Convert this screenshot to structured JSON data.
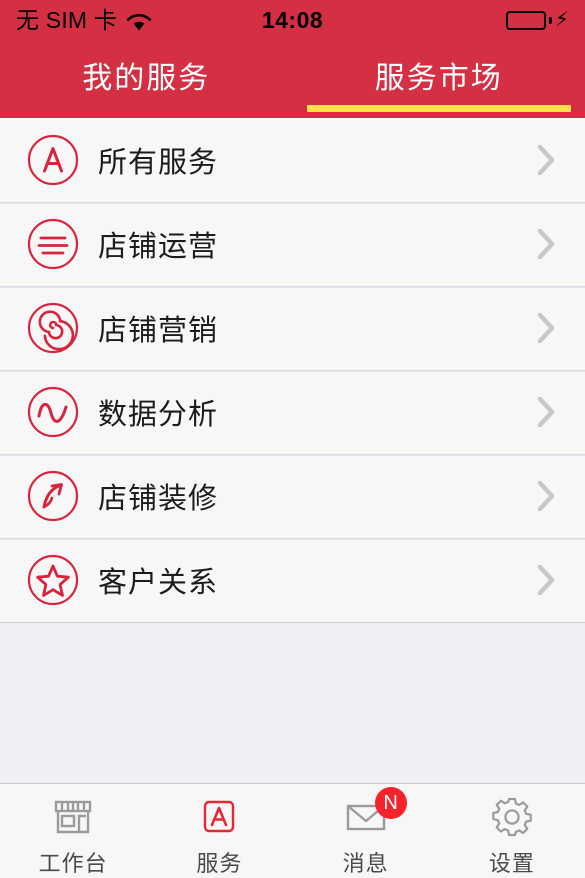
{
  "status_bar": {
    "carrier": "无 SIM 卡",
    "wifi_icon": "wifi-icon",
    "time": "14:08",
    "battery_icon": "battery-full-icon",
    "charging_icon": "lightning-bolt-icon"
  },
  "nav": {
    "tabs": [
      {
        "label": "我的服务",
        "active": false
      },
      {
        "label": "服务市场",
        "active": true
      }
    ],
    "indicator_color": "#ffe14d",
    "bar_color": "#d42f43"
  },
  "list": {
    "rows": [
      {
        "label": "所有服务",
        "icon": "circle-letter-a-icon",
        "chevron": "chevron-right-icon"
      },
      {
        "label": "店铺运营",
        "icon": "circle-lines-icon",
        "chevron": "chevron-right-icon"
      },
      {
        "label": "店铺营销",
        "icon": "circle-spiral-icon",
        "chevron": "chevron-right-icon"
      },
      {
        "label": "数据分析",
        "icon": "circle-wave-icon",
        "chevron": "chevron-right-icon"
      },
      {
        "label": "店铺装修",
        "icon": "circle-brush-arrow-icon",
        "chevron": "chevron-right-icon"
      },
      {
        "label": "客户关系",
        "icon": "circle-star-icon",
        "chevron": "chevron-right-icon"
      }
    ],
    "icon_color": "#d8243c",
    "row_background": "#f7f7f7",
    "page_background": "#efeff4"
  },
  "tabbar": {
    "items": [
      {
        "label": "工作台",
        "icon": "storefront-icon",
        "active": false,
        "badge": ""
      },
      {
        "label": "服务",
        "icon": "letter-a-box-icon",
        "active": true,
        "badge": ""
      },
      {
        "label": "消息",
        "icon": "envelope-icon",
        "active": false,
        "badge": "N"
      },
      {
        "label": "设置",
        "icon": "gear-icon",
        "active": false,
        "badge": ""
      }
    ],
    "active_color": "#e8262f",
    "inactive_color": "#9b9b9f"
  }
}
